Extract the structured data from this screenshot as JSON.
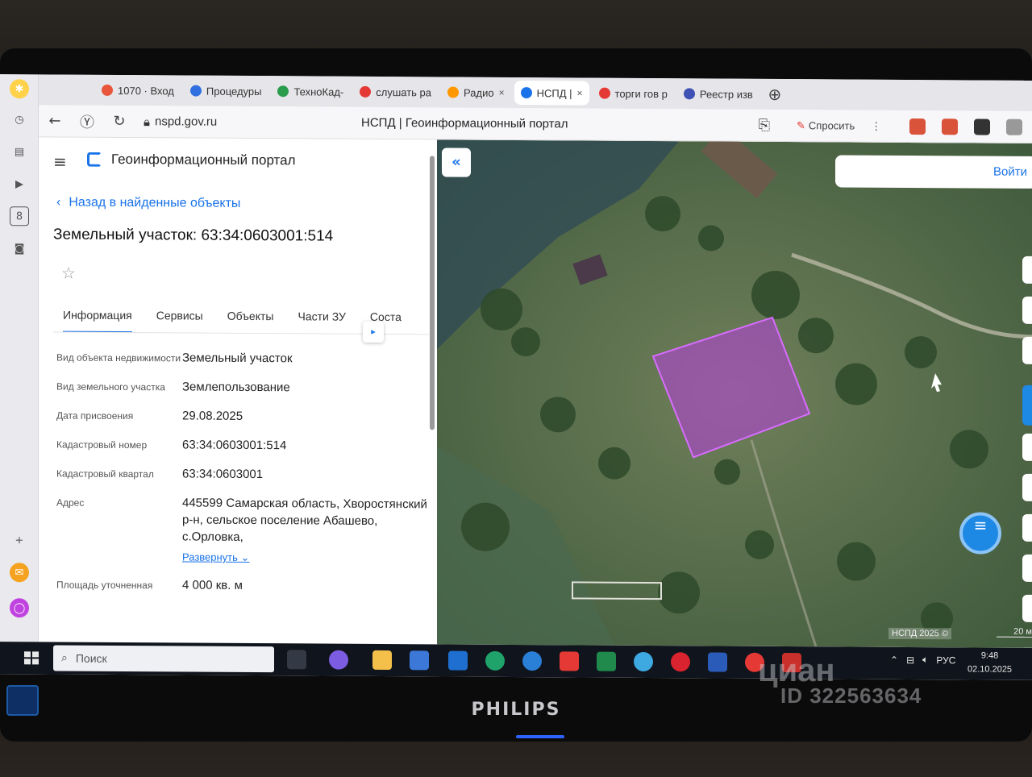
{
  "browser": {
    "tabs": [
      {
        "label": "1070 · Вход",
        "color": "#e8553a"
      },
      {
        "label": "Процедуры",
        "color": "#2f6fe0"
      },
      {
        "label": "ТехноКад-",
        "color": "#2a9d4c"
      },
      {
        "label": "слушать ра",
        "color": "#e53935"
      },
      {
        "label": "Радио",
        "color": "#ff9800"
      },
      {
        "label": "НСПД |",
        "color": "#1a73e8",
        "active": true
      },
      {
        "label": "торги гов р",
        "color": "#e53935"
      },
      {
        "label": "Реестр изв",
        "color": "#3f51b5"
      }
    ],
    "url": "nspd.gov.ru",
    "page_title": "НСПД | Геоинформационный портал",
    "ask_label": "Спросить"
  },
  "panel": {
    "portal_name": "Геоинформационный портал",
    "back_label": "Назад в найденные объекты",
    "object_title": "Земельный участок: 63:34:0603001:514",
    "tabs": [
      "Информация",
      "Сервисы",
      "Объекты",
      "Части ЗУ",
      "Соста"
    ],
    "rows": [
      {
        "key": "Вид объекта недвижимости",
        "value": "Земельный участок"
      },
      {
        "key": "Вид земельного участка",
        "value": "Землепользование"
      },
      {
        "key": "Дата присвоения",
        "value": "29.08.2025"
      },
      {
        "key": "Кадастровый номер",
        "value": "63:34:0603001:514"
      },
      {
        "key": "Кадастровый квартал",
        "value": "63:34:0603001"
      },
      {
        "key": "Адрес",
        "value": "445599 Самарская область, Хворостянский р-н, сельское поселение Абашево, с.Орловка,"
      },
      {
        "key": "Площадь уточненная",
        "value": "4 000 кв. м"
      }
    ],
    "expand_label": "Развернуть"
  },
  "map": {
    "login_label": "Войти",
    "attribution": "НСПД 2025 ©",
    "scale_label": "20 м",
    "parcel_color": "#b83ee0"
  },
  "taskbar": {
    "search_placeholder": "Поиск",
    "lang": "РУС",
    "time": "9:48",
    "date": "02.10.2025"
  },
  "monitor": {
    "brand": "PHILIPS",
    "watermark": "циан",
    "watermark_id": "ID 322563634"
  }
}
